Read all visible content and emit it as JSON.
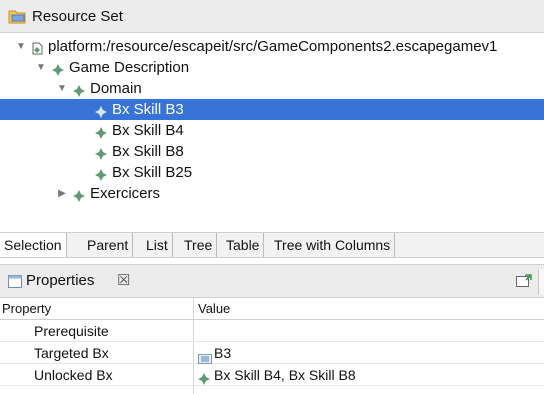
{
  "resource_set": {
    "title": "Resource Set",
    "icon": "folder-icon"
  },
  "tree": {
    "nodes": [
      {
        "label": "platform:/resource/escapeit/src/GameComponents2.escapegamev1",
        "icon": "resource-file-icon",
        "expanded": true
      },
      {
        "label": "Game Description",
        "icon": "diamond-node-icon",
        "expanded": true
      },
      {
        "label": "Domain",
        "icon": "diamond-node-icon",
        "expanded": true
      },
      {
        "label": "Bx Skill B3",
        "icon": "diamond-node-icon",
        "selected": true
      },
      {
        "label": "Bx Skill B4",
        "icon": "diamond-node-icon"
      },
      {
        "label": "Bx Skill B8",
        "icon": "diamond-node-icon"
      },
      {
        "label": "Bx Skill B25",
        "icon": "diamond-node-icon"
      },
      {
        "label": "Exercicers",
        "icon": "diamond-node-icon",
        "expanded": false
      }
    ]
  },
  "tabs": [
    "Selection",
    "Parent",
    "List",
    "Tree",
    "Table",
    "Tree with Columns"
  ],
  "properties": {
    "title": "Properties",
    "close": "☒",
    "columns": {
      "property": "Property",
      "value": "Value"
    },
    "rows": [
      {
        "name": "Prerequisite",
        "value": ""
      },
      {
        "name": "Targeted Bx",
        "value": "B3",
        "icon": "list-icon"
      },
      {
        "name": "Unlocked Bx",
        "value": "Bx Skill B4, Bx Skill B8",
        "icon": "diamond-node-icon"
      }
    ]
  },
  "colors": {
    "selection": "#3874d8",
    "header": "#ececec",
    "icon_green": "#5f9a73"
  }
}
